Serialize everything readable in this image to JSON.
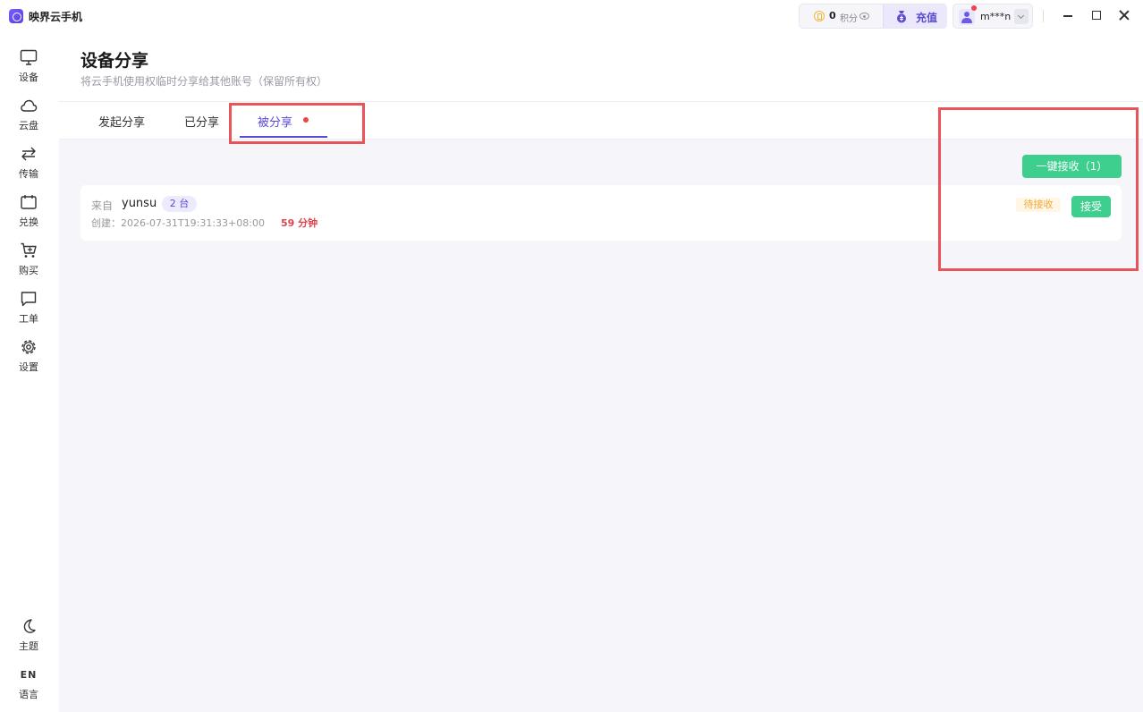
{
  "app": {
    "title": "映界云手机"
  },
  "topbar": {
    "points_value": "0",
    "points_label": "积分",
    "recharge_label": "充值",
    "username": "m***n"
  },
  "sidebar": {
    "items": [
      {
        "label": "设备"
      },
      {
        "label": "云盘"
      },
      {
        "label": "传输"
      },
      {
        "label": "兑换"
      },
      {
        "label": "购买"
      },
      {
        "label": "工单"
      },
      {
        "label": "设置"
      }
    ],
    "bottom": [
      {
        "label": "主题"
      },
      {
        "mark": "EN",
        "label": "语言"
      }
    ]
  },
  "header": {
    "title": "设备分享",
    "subtitle": "将云手机使用权临时分享给其他账号（保留所有权）"
  },
  "tabs": [
    {
      "label": "发起分享"
    },
    {
      "label": "已分享"
    },
    {
      "label": "被分享"
    }
  ],
  "main": {
    "bulk_accept_label": "一键接收（1）",
    "shares": [
      {
        "from_label": "来自",
        "from_user": "yunsu",
        "count": "2 台",
        "created": "创建：2026-07-31T19:31:33+08:00",
        "remaining": "59 分钟",
        "status": "待接收",
        "accept_label": "接受"
      }
    ]
  },
  "colors": {
    "accent": "#5a4bd6",
    "success": "#3ecf8e",
    "danger": "#e0434f",
    "warning": "#f2a93b",
    "highlight": "#e9545a"
  }
}
